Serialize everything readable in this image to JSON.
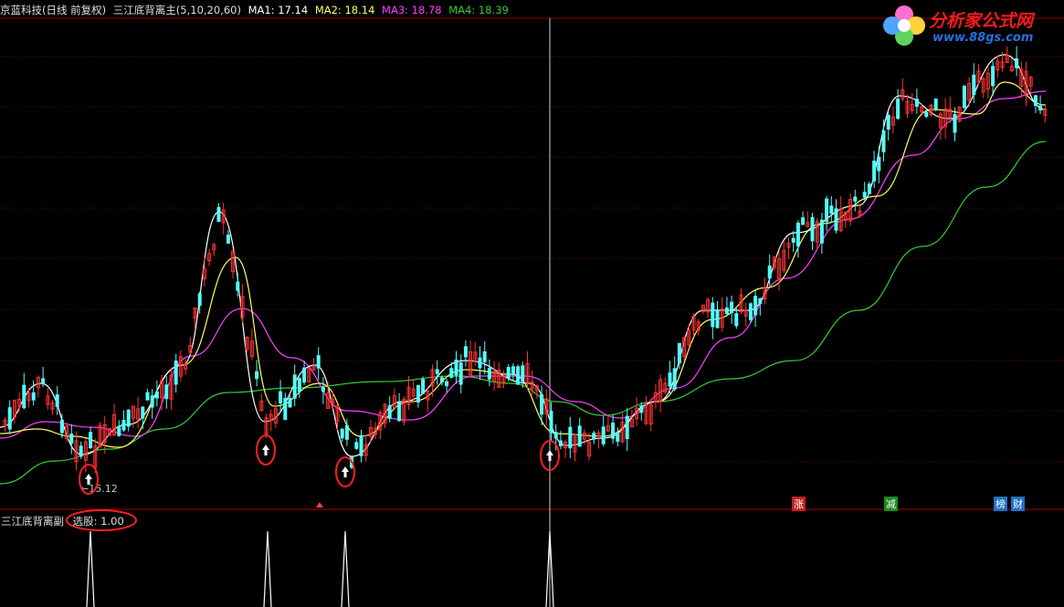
{
  "header": {
    "stock": "京蓝科技(日线 前复权)",
    "indicator": "三江底背离主(5,10,20,60)",
    "ma1": "MA1: 17.14",
    "ma2": "MA2: 18.14",
    "ma3": "MA3: 18.78",
    "ma4": "MA4: 18.39"
  },
  "colors": {
    "up": "#ff3232",
    "down": "#54fcfc",
    "ma1": "#ffffff",
    "ma2": "#ffff66",
    "ma3": "#ff40ff",
    "ma4": "#33cc33",
    "signal_circle": "#ff2020",
    "grid": "#7a0000"
  },
  "low_label": "15.12",
  "sub": {
    "title": "三江底背离副",
    "value": "选股: 1.00"
  },
  "tags": [
    "涨",
    "减",
    "榜",
    "财"
  ],
  "logo": {
    "text": "分析家公式网",
    "url": "www.88gs.com",
    "icon": "flower-logo-icon"
  },
  "signals": {
    "count": 4,
    "icon": "up-arrow-icon"
  }
}
